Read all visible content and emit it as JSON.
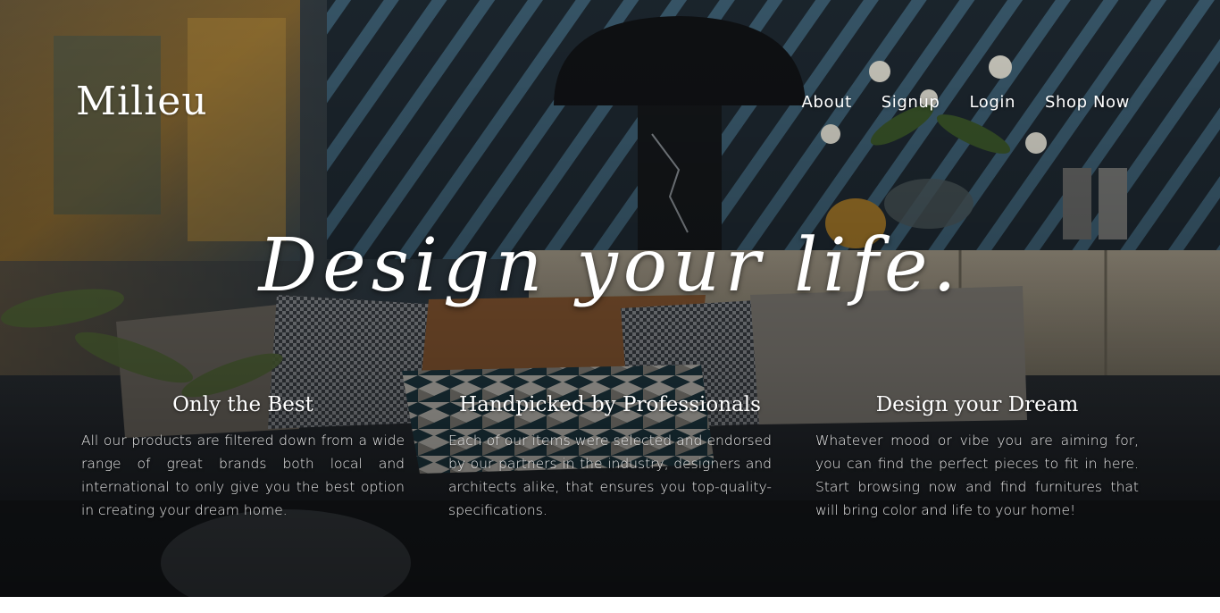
{
  "brand": {
    "name": "Milieu"
  },
  "nav": {
    "items": [
      {
        "label": "About"
      },
      {
        "label": "Signup"
      },
      {
        "label": "Login"
      },
      {
        "label": "Shop Now"
      }
    ]
  },
  "hero": {
    "tagline": "Design your life."
  },
  "features": [
    {
      "title": "Only the Best",
      "text": "All our products are filtered down from a wide range of great brands both local and international to only give you the best option in creating your dream home."
    },
    {
      "title": "Handpicked by Professionals",
      "text": "Each of our items were selected and endorsed by our partners in the industry, designers and architects alike, that ensures you top-quality-specifications."
    },
    {
      "title": "Design your Dream",
      "text": "Whatever mood or vibe you are aiming for, you can find the perfect pieces to fit in here. Start browsing now and find furnitures that will bring color and life to your home!"
    }
  ],
  "colors": {
    "text": "#ffffff",
    "overlay": "#1d2127"
  }
}
